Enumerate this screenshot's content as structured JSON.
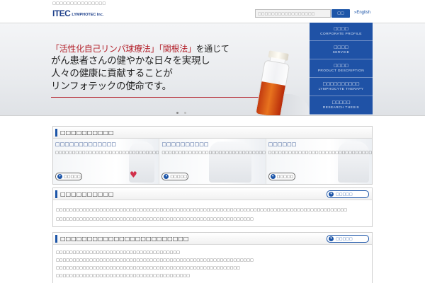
{
  "top_note": "□□□□□□□□□□□□□□□",
  "header": {
    "logo_mark": "ITEC",
    "logo_text": "LYMPHOTEC Inc.",
    "search_placeholder": "□□□□□□□□□□□□□□□□□",
    "search_button": "□□",
    "language_link": "»English"
  },
  "hero": {
    "line1_quote": "「活性化自己リンパ球療法」「関根法」",
    "line1_suffix": "を通じて",
    "line2": "がん患者さんの健やかな日々を実現し",
    "line3": "人々の健康に貢献することが",
    "line4": "リンフォテックの使命です。"
  },
  "hero_menu": [
    {
      "jp": "□□□□",
      "en": "CORPORATE PROFILE"
    },
    {
      "jp": "□□□□",
      "en": "SERVICE"
    },
    {
      "jp": "□□□□",
      "en": "PRODUCT DESCRIPTION"
    },
    {
      "jp": "□□□□□□□□□□",
      "en": "LYMPHOCYTE THERAPY"
    },
    {
      "jp": "□□□□□",
      "en": "RESEARCH THESIS"
    }
  ],
  "features_section": {
    "title": "□□□□□□□□□□",
    "items": [
      {
        "title": "□□□□□□□□□□□□□",
        "body": "□□□□□□□□□□□□□□□□□□□□□□□□□□□□□□□□□□□□□□□□□□□□□□□□□□□□□□",
        "button": "□□□□□"
      },
      {
        "title": "□□□□□□□□□□",
        "body": "□□□□□□□□□□□□□□□□□□□□□□□□□□□□□□□□□□□□□□□□□□□",
        "button": "□□□□□"
      },
      {
        "title": "□□□□□□",
        "body": "□□□□□□□□□□□□□□□□□□□□□□□□□□□□□□□",
        "button": "□□□□□"
      }
    ]
  },
  "news_section": {
    "title": "□□□□□□□□□□",
    "more": "□□□□□",
    "rows": [
      "□□□□□□□□□□□□□□□□□□□□□□□□□□□□□□□□□□□□□□□□□□□□□□□□□□□□□□□□□□□□□□□□□□□□□□□□□□□□□□□□□□□□□□□",
      "□□□□□□□□□□□□□□□□□□□□□□□□□□□□□□□□□□□□□□□□□□□□□□□□□□□□□□□□□□□"
    ]
  },
  "info_section": {
    "title": "□□□□□□□□□□□□□□□□□□□□□□□□",
    "more": "□□□□□",
    "rows": [
      "□□□□□□□□□□□□□□□□□□□□□□□□□□□□□□□□□□□□□",
      "□□□□□□□□□□□□□□□□□□□□□□□□□□□□□□□□□□□□□□□□□□□□□□□□□□□□□□□□□□□",
      "",
      "□□□□□□□□□□□□□□□□□□□□□□□□□□□□□□□□□□□□□□□□□□□□□□□□□□□□□□□",
      "□□□□□□□□□□□□□□□□□□□□□□□□□□□□□□□□□□□□□□□□"
    ]
  },
  "colors": {
    "brand_blue": "#1f52a6",
    "accent_red": "#b3202a"
  }
}
